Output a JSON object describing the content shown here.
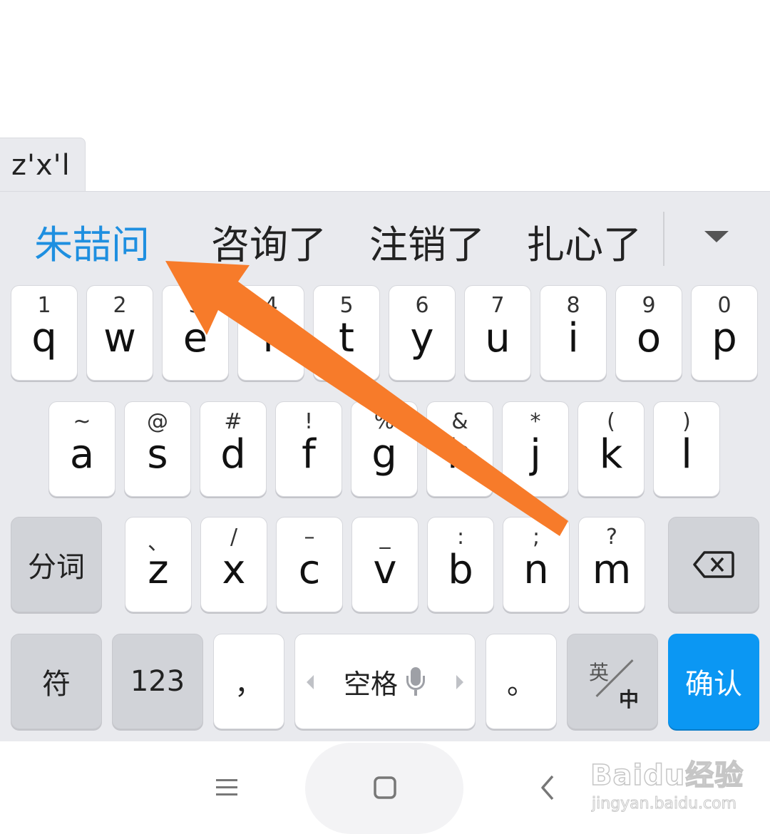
{
  "composing": {
    "text": "z'x'l"
  },
  "candidates": {
    "items": [
      "朱喆问",
      "咨询了",
      "注销了",
      "扎心了"
    ]
  },
  "keyboard": {
    "row1": [
      {
        "sub": "1",
        "main": "q"
      },
      {
        "sub": "2",
        "main": "w"
      },
      {
        "sub": "3",
        "main": "e"
      },
      {
        "sub": "4",
        "main": "r"
      },
      {
        "sub": "5",
        "main": "t"
      },
      {
        "sub": "6",
        "main": "y"
      },
      {
        "sub": "7",
        "main": "u"
      },
      {
        "sub": "8",
        "main": "i"
      },
      {
        "sub": "9",
        "main": "o"
      },
      {
        "sub": "0",
        "main": "p"
      }
    ],
    "row2": [
      {
        "sub": "~",
        "main": "a"
      },
      {
        "sub": "@",
        "main": "s"
      },
      {
        "sub": "#",
        "main": "d"
      },
      {
        "sub": "!",
        "main": "f"
      },
      {
        "sub": "%",
        "main": "g"
      },
      {
        "sub": "&",
        "main": "h"
      },
      {
        "sub": "*",
        "main": "j"
      },
      {
        "sub": "(",
        "main": "k"
      },
      {
        "sub": ")",
        "main": "l"
      }
    ],
    "row3": [
      {
        "sub": "、",
        "main": "z"
      },
      {
        "sub": "/",
        "main": "x"
      },
      {
        "sub": "–",
        "main": "c"
      },
      {
        "sub": "_",
        "main": "v"
      },
      {
        "sub": ":",
        "main": "b"
      },
      {
        "sub": ";",
        "main": "n"
      },
      {
        "sub": "?",
        "main": "m"
      }
    ],
    "segment_label": "分词",
    "symbol_label": "符",
    "numeric_label": "123",
    "comma_label": "，",
    "space_label": "空格",
    "period_label": "。",
    "lang_top": "英",
    "lang_bottom": "中",
    "confirm_label": "确认"
  },
  "colors": {
    "candidate_highlight": "#1e8fe0",
    "confirm_key": "#0b97f3",
    "annotation_arrow": "#f77b2a"
  },
  "icons": {
    "backspace": "backspace-icon",
    "mic": "mic-icon",
    "expand": "chevron-down-icon",
    "menu": "menu-icon",
    "home": "home-icon",
    "back": "back-icon"
  },
  "watermark": {
    "brand": "Baidu经验",
    "url": "jingyan.baidu.com"
  }
}
